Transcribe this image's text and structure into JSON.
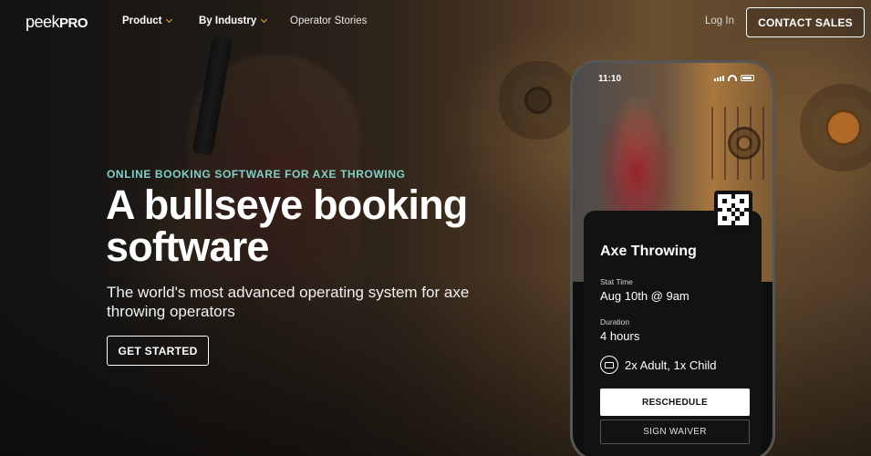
{
  "nav": {
    "logo_peek": "peek",
    "logo_pro": "PRO",
    "items": [
      {
        "label": "Product"
      },
      {
        "label": "By Industry"
      },
      {
        "label": "Operator Stories"
      }
    ],
    "login": "Log In",
    "contact": "CONTACT SALES"
  },
  "hero": {
    "eyebrow": "ONLINE BOOKING SOFTWARE FOR AXE THROWING",
    "headline": "A bullseye booking software",
    "subhead": "The world's most advanced operating system for axe throwing operators",
    "cta": "GET STARTED"
  },
  "phone": {
    "time": "11:10",
    "card": {
      "title": "Axe Throwing",
      "start_label": "Stat Time",
      "start_value": "Aug 10th @ 9am",
      "duration_label": "Duration",
      "duration_value": "4 hours",
      "tickets": "2x Adult, 1x Child",
      "reschedule": "RESCHEDULE",
      "waiver": "SIGN WAIVER"
    }
  },
  "colors": {
    "eyebrow": "#7fd1c9",
    "nav_chevron": "#f0b23a",
    "card_bg": "#121212"
  },
  "icons": [
    "chevron-down-icon",
    "signal-icon",
    "wifi-icon",
    "battery-icon",
    "qr-code-icon",
    "ticket-icon"
  ]
}
